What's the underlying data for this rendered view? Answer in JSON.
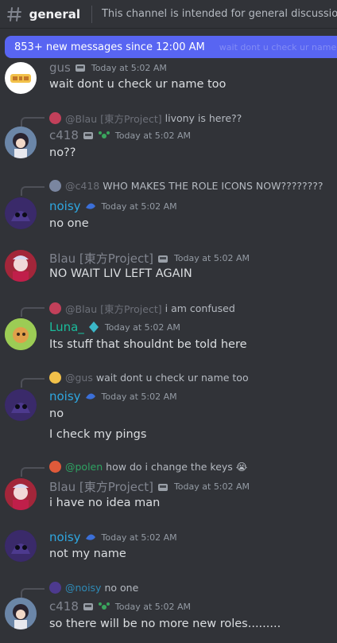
{
  "header": {
    "channel": "general",
    "topic": "This channel is intended for general discussions."
  },
  "banner": {
    "label": "853+ new messages since 12:00 AM",
    "ghost": "wait dont u check ur name too"
  },
  "colors": {
    "bg": "#313338",
    "accent": "#5865f2",
    "gray_name": "#80848e",
    "blue_name": "#2ea7e0",
    "cyan_name": "#1abc9c",
    "green_mention": "#2dc770"
  },
  "messages": [
    {
      "author": "gus",
      "time": "Today at 5:02 AM",
      "lines": [
        "wait dont u check ur name too"
      ]
    },
    {
      "reply": {
        "author": "@Blau [東方Project]",
        "text": "livony is here??"
      },
      "author": "c418",
      "time": "Today at 5:02 AM",
      "lines": [
        "no??"
      ]
    },
    {
      "reply": {
        "author": "@c418",
        "text": "WHO MAKES THE ROLE ICONS NOW????????"
      },
      "author": "noisy",
      "time": "Today at 5:02 AM",
      "lines": [
        "no one"
      ]
    },
    {
      "author": "Blau [東方Project]",
      "time": "Today at 5:02 AM",
      "lines": [
        "NO WAIT LIV LEFT AGAIN"
      ]
    },
    {
      "reply": {
        "author": "@Blau [東方Project]",
        "text": "i am confused"
      },
      "author": "Luna_",
      "time": "Today at 5:02 AM",
      "lines": [
        "Its stuff that shouldnt be told here"
      ]
    },
    {
      "reply": {
        "author": "@gus",
        "text": "wait dont u check ur name too"
      },
      "author": "noisy",
      "time": "Today at 5:02 AM",
      "lines": [
        "no",
        "I check my pings"
      ]
    },
    {
      "reply": {
        "author": "@polen",
        "text": "how do i change the keys 😭"
      },
      "author": "Blau [東方Project]",
      "time": "Today at 5:02 AM",
      "lines": [
        "i have no idea man"
      ]
    },
    {
      "author": "noisy",
      "time": "Today at 5:02 AM",
      "lines": [
        "not my name"
      ]
    },
    {
      "reply": {
        "author": "@noisy",
        "text": "no one"
      },
      "author": "c418",
      "time": "Today at 5:02 AM",
      "lines": [
        "so there will be no more new roles........."
      ]
    }
  ]
}
